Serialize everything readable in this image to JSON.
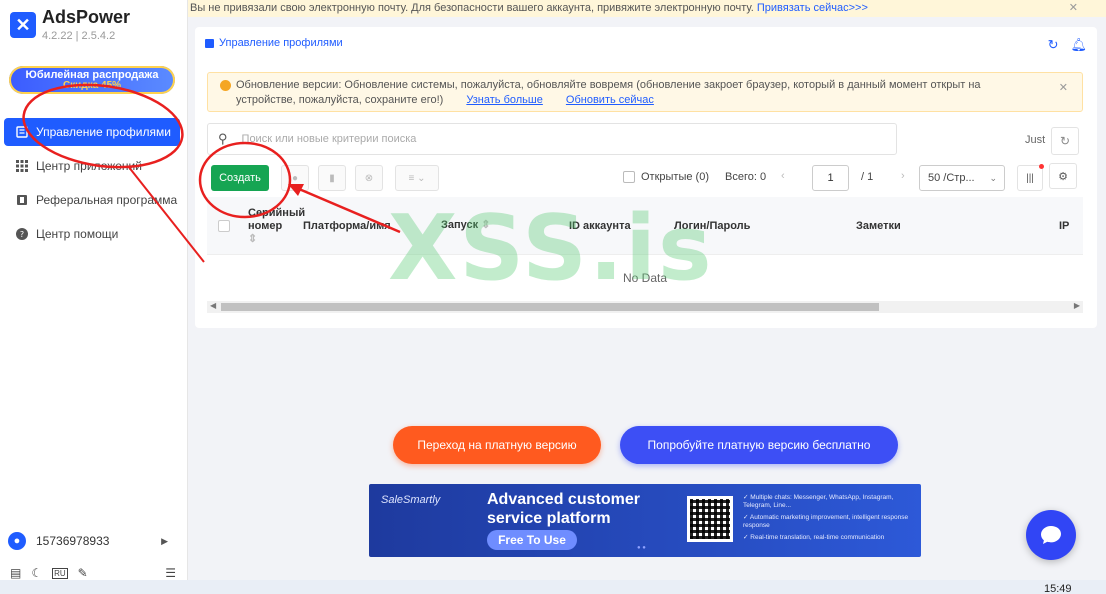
{
  "app": {
    "name": "AdsPower",
    "version": "4.2.22 | 2.5.4.2",
    "brand_color": "#1f5cff"
  },
  "sidebar": {
    "promo_line1": "Юбилейная распродажа",
    "promo_line2": "Скидка 45%",
    "items": [
      {
        "label": "Управление профилями",
        "icon": "profiles-icon",
        "active": true
      },
      {
        "label": "Центр приложений",
        "icon": "apps-grid-icon",
        "active": false
      },
      {
        "label": "Реферальная программа",
        "icon": "referral-icon",
        "active": false
      },
      {
        "label": "Центр помощи",
        "icon": "help-icon",
        "active": false
      }
    ],
    "user_phone": "15736978933",
    "lang_badge": "RU"
  },
  "top_banner": {
    "text": "Вы не привязали свою электронную почту. Для безопасности вашего аккаунта, привяжите электронную почту.",
    "link": "Привязать сейчас>>>"
  },
  "panel": {
    "tab_label": "Управление профилями",
    "notice": {
      "text": "Обновление версии: Обновление системы, пожалуйста, обновляйте вовремя (обновление закроет браузер, который в данный момент открыт на устройстве, пожалуйста, сохраните его!)",
      "learn_more": "Узнать больше",
      "update_now": "Обновить сейчас"
    },
    "search_placeholder": "Поиск или новые критерии поиска",
    "just_label": "Just",
    "create_label": "Создать",
    "opened_label": "Открытые (0)",
    "total_label": "Всего: 0",
    "page_current": "1",
    "page_total": "/ 1",
    "per_page": "50 /Стр...",
    "columns": {
      "serial": "Серийный номер",
      "platform": "Платформа/имя",
      "launch": "Запуск",
      "account_id": "ID аккаунта",
      "login": "Логин/Пароль",
      "notes": "Заметки",
      "ip": "IP"
    },
    "no_data": "No Data"
  },
  "cta": {
    "paid": "Переход на платную версию",
    "trial": "Попробуйте платную версию бесплатно"
  },
  "ad": {
    "brand": "SaleSmartly",
    "headline": "Advanced customer service platform",
    "button": "Free To Use",
    "features": [
      "Multiple chats: Messenger, WhatsApp, Instagram, Telegram, Line...",
      "Automatic marketing improvement, intelligent response response",
      "Real-time translation, real-time communication"
    ]
  },
  "watermark": "XSS.is",
  "taskbar_time": "15:49"
}
